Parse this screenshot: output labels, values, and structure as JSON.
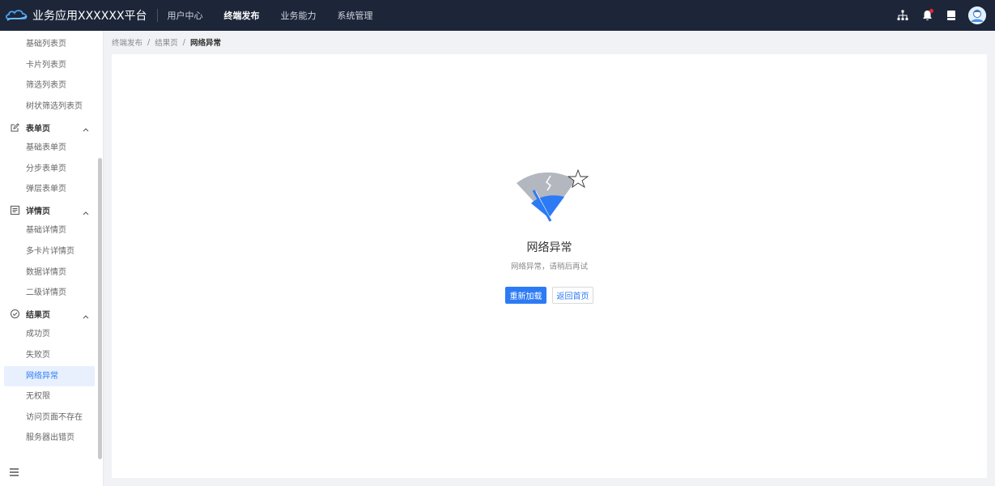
{
  "header": {
    "app_title": "业务应用XXXXXX平台",
    "nav": [
      {
        "label": "用户中心",
        "active": false
      },
      {
        "label": "终端发布",
        "active": true
      },
      {
        "label": "业务能力",
        "active": false
      },
      {
        "label": "系统管理",
        "active": false
      }
    ],
    "icons": [
      "sitemap-icon",
      "bell-icon",
      "document-icon",
      "user-avatar"
    ]
  },
  "sidebar": {
    "items": [
      {
        "type": "item",
        "label": "基础列表页"
      },
      {
        "type": "item",
        "label": "卡片列表页"
      },
      {
        "type": "item",
        "label": "筛选列表页"
      },
      {
        "type": "item",
        "label": "树状筛选列表页"
      },
      {
        "type": "group",
        "label": "表单页",
        "icon": "edit-icon"
      },
      {
        "type": "item",
        "label": "基础表单页"
      },
      {
        "type": "item",
        "label": "分步表单页"
      },
      {
        "type": "item",
        "label": "弹层表单页"
      },
      {
        "type": "group",
        "label": "详情页",
        "icon": "list-icon"
      },
      {
        "type": "item",
        "label": "基础详情页"
      },
      {
        "type": "item",
        "label": "多卡片详情页"
      },
      {
        "type": "item",
        "label": "数据详情页"
      },
      {
        "type": "item",
        "label": "二级详情页"
      },
      {
        "type": "group",
        "label": "结果页",
        "icon": "check-circle-icon"
      },
      {
        "type": "item",
        "label": "成功页"
      },
      {
        "type": "item",
        "label": "失败页"
      },
      {
        "type": "item",
        "label": "网络异常",
        "selected": true
      },
      {
        "type": "item",
        "label": "无权限"
      },
      {
        "type": "item",
        "label": "访问页面不存在"
      },
      {
        "type": "item",
        "label": "服务器出错页"
      }
    ]
  },
  "breadcrumb": {
    "items": [
      "终端发布",
      "结果页"
    ],
    "separator": "/",
    "current": "网络异常"
  },
  "result": {
    "title": "网络异常",
    "subtitle": "网络异常，请稍后再试",
    "primary_button": "重新加载",
    "secondary_button": "返回首页"
  },
  "colors": {
    "header_bg": "#1d2639",
    "accent": "#2d7bf4",
    "page_bg": "#f0f2f5"
  }
}
